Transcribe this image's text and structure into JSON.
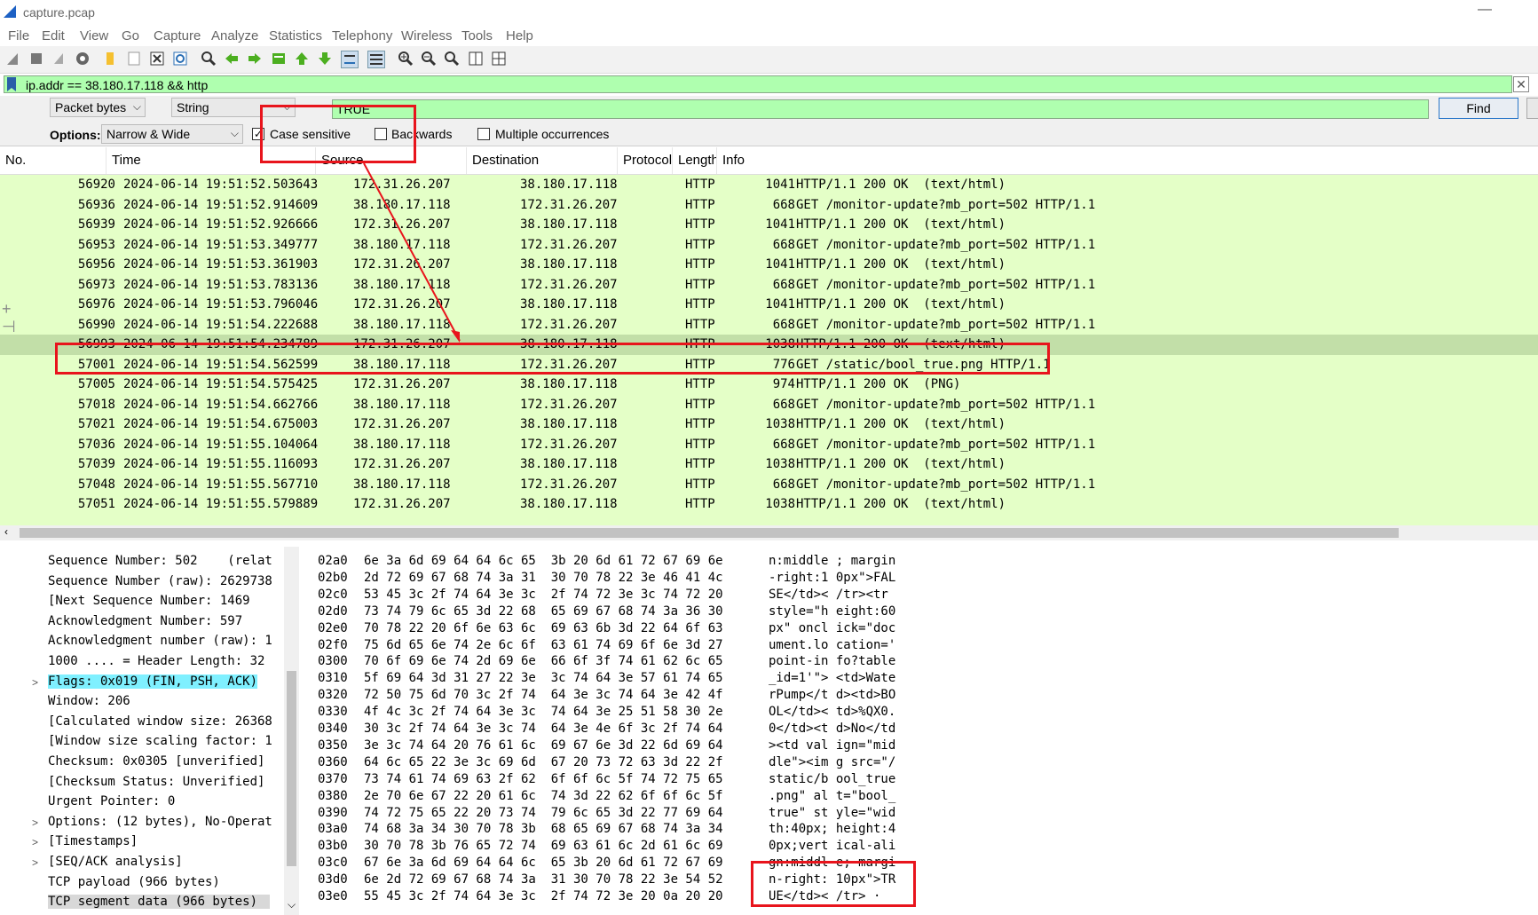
{
  "window": {
    "title": "capture.pcap"
  },
  "menu": [
    "File",
    "Edit",
    "View",
    "Go",
    "Capture",
    "Analyze",
    "Statistics",
    "Telephony",
    "Wireless",
    "Tools",
    "Help"
  ],
  "toolbar": {
    "icons": [
      "shark-fin-start-icon",
      "stop-icon",
      "restart-icon",
      "capture-options-icon",
      "open-file-icon",
      "file-icon",
      "close-file-icon",
      "reload-icon",
      "find-icon",
      "back-arrow-icon",
      "forward-arrow-icon",
      "go-to-packet-icon",
      "first-packet-icon",
      "last-packet-icon",
      "autoscroll-icon",
      "colorize-icon",
      "zoom-in-icon",
      "zoom-out-icon",
      "normal-size-icon",
      "resize-columns-icon",
      "layout-icon"
    ]
  },
  "filter": {
    "value": "ip.addr == 38.180.17.118 && http"
  },
  "find": {
    "search_in": "Packet bytes",
    "type": "String",
    "type_extra": "",
    "value": "TRUE",
    "button": "Find",
    "options_label": "Options:",
    "charset": "Narrow & Wide",
    "case_sensitive": "Case sensitive",
    "case_checked": "✓",
    "backwards": "Backwards",
    "multiple": "Multiple occurrences"
  },
  "packet_list": {
    "columns": [
      "No.",
      "Time",
      "Source",
      "Destination",
      "Protocol",
      "Length",
      "Info"
    ],
    "rows": [
      {
        "no": "56920",
        "time": "2024-06-14 19:51:52.503643",
        "src": "172.31.26.207",
        "dst": "38.180.17.118",
        "proto": "HTTP",
        "len": "1041",
        "info": "HTTP/1.1 200 OK  (text/html)"
      },
      {
        "no": "56936",
        "time": "2024-06-14 19:51:52.914609",
        "src": "38.180.17.118",
        "dst": "172.31.26.207",
        "proto": "HTTP",
        "len": "668",
        "info": "GET /monitor-update?mb_port=502 HTTP/1.1"
      },
      {
        "no": "56939",
        "time": "2024-06-14 19:51:52.926666",
        "src": "172.31.26.207",
        "dst": "38.180.17.118",
        "proto": "HTTP",
        "len": "1041",
        "info": "HTTP/1.1 200 OK  (text/html)"
      },
      {
        "no": "56953",
        "time": "2024-06-14 19:51:53.349777",
        "src": "38.180.17.118",
        "dst": "172.31.26.207",
        "proto": "HTTP",
        "len": "668",
        "info": "GET /monitor-update?mb_port=502 HTTP/1.1"
      },
      {
        "no": "56956",
        "time": "2024-06-14 19:51:53.361903",
        "src": "172.31.26.207",
        "dst": "38.180.17.118",
        "proto": "HTTP",
        "len": "1041",
        "info": "HTTP/1.1 200 OK  (text/html)"
      },
      {
        "no": "56973",
        "time": "2024-06-14 19:51:53.783136",
        "src": "38.180.17.118",
        "dst": "172.31.26.207",
        "proto": "HTTP",
        "len": "668",
        "info": "GET /monitor-update?mb_port=502 HTTP/1.1"
      },
      {
        "no": "56976",
        "time": "2024-06-14 19:51:53.796046",
        "src": "172.31.26.207",
        "dst": "38.180.17.118",
        "proto": "HTTP",
        "len": "1041",
        "info": "HTTP/1.1 200 OK  (text/html)"
      },
      {
        "no": "56990",
        "time": "2024-06-14 19:51:54.222688",
        "src": "38.180.17.118",
        "dst": "172.31.26.207",
        "proto": "HTTP",
        "len": "668",
        "info": "GET /monitor-update?mb_port=502 HTTP/1.1"
      },
      {
        "no": "56993",
        "time": "2024-06-14 19:51:54.234789",
        "src": "172.31.26.207",
        "dst": "38.180.17.118",
        "proto": "HTTP",
        "len": "1038",
        "info": "HTTP/1.1 200 OK  (text/html)"
      },
      {
        "no": "57001",
        "time": "2024-06-14 19:51:54.562599",
        "src": "38.180.17.118",
        "dst": "172.31.26.207",
        "proto": "HTTP",
        "len": "776",
        "info": "GET /static/bool_true.png HTTP/1.1"
      },
      {
        "no": "57005",
        "time": "2024-06-14 19:51:54.575425",
        "src": "172.31.26.207",
        "dst": "38.180.17.118",
        "proto": "HTTP",
        "len": "974",
        "info": "HTTP/1.1 200 OK  (PNG)"
      },
      {
        "no": "57018",
        "time": "2024-06-14 19:51:54.662766",
        "src": "38.180.17.118",
        "dst": "172.31.26.207",
        "proto": "HTTP",
        "len": "668",
        "info": "GET /monitor-update?mb_port=502 HTTP/1.1"
      },
      {
        "no": "57021",
        "time": "2024-06-14 19:51:54.675003",
        "src": "172.31.26.207",
        "dst": "38.180.17.118",
        "proto": "HTTP",
        "len": "1038",
        "info": "HTTP/1.1 200 OK  (text/html)"
      },
      {
        "no": "57036",
        "time": "2024-06-14 19:51:55.104064",
        "src": "38.180.17.118",
        "dst": "172.31.26.207",
        "proto": "HTTP",
        "len": "668",
        "info": "GET /monitor-update?mb_port=502 HTTP/1.1"
      },
      {
        "no": "57039",
        "time": "2024-06-14 19:51:55.116093",
        "src": "172.31.26.207",
        "dst": "38.180.17.118",
        "proto": "HTTP",
        "len": "1038",
        "info": "HTTP/1.1 200 OK  (text/html)"
      },
      {
        "no": "57048",
        "time": "2024-06-14 19:51:55.567710",
        "src": "38.180.17.118",
        "dst": "172.31.26.207",
        "proto": "HTTP",
        "len": "668",
        "info": "GET /monitor-update?mb_port=502 HTTP/1.1"
      },
      {
        "no": "57051",
        "time": "2024-06-14 19:51:55.579889",
        "src": "172.31.26.207",
        "dst": "38.180.17.118",
        "proto": "HTTP",
        "len": "1038",
        "info": "HTTP/1.1 200 OK  (text/html)"
      }
    ],
    "selected_no": "56993"
  },
  "details": [
    {
      "text": "Sequence Number: 502    (relat",
      "exp": ""
    },
    {
      "text": "Sequence Number (raw): 2629738",
      "exp": ""
    },
    {
      "text": "[Next Sequence Number: 1469",
      "exp": ""
    },
    {
      "text": "Acknowledgment Number: 597",
      "exp": ""
    },
    {
      "text": "Acknowledgment number (raw): 1",
      "exp": ""
    },
    {
      "text": "1000 .... = Header Length: 32",
      "exp": ""
    },
    {
      "text": "Flags: 0x019 (FIN, PSH, ACK)",
      "exp": ">",
      "highlight": true
    },
    {
      "text": "Window: 206",
      "exp": ""
    },
    {
      "text": "[Calculated window size: 26368",
      "exp": ""
    },
    {
      "text": "[Window size scaling factor: 1",
      "exp": ""
    },
    {
      "text": "Checksum: 0x0305 [unverified]",
      "exp": ""
    },
    {
      "text": "[Checksum Status: Unverified]",
      "exp": ""
    },
    {
      "text": "Urgent Pointer: 0",
      "exp": ""
    },
    {
      "text": "Options: (12 bytes), No-Operat",
      "exp": ">"
    },
    {
      "text": "[Timestamps]",
      "exp": ">"
    },
    {
      "text": "[SEQ/ACK analysis]",
      "exp": ">"
    },
    {
      "text": "TCP payload (966 bytes)",
      "exp": ""
    },
    {
      "text": "TCP segment data (966 bytes)",
      "exp": "",
      "selected": true
    }
  ],
  "bytes": [
    {
      "off": "02a0",
      "hex": "6e 3a 6d 69 64 64 6c 65  3b 20 6d 61 72 67 69 6e",
      "asc": "n:middle ; margin"
    },
    {
      "off": "02b0",
      "hex": "2d 72 69 67 68 74 3a 31  30 70 78 22 3e 46 41 4c",
      "asc": "-right:1 0px\">FAL"
    },
    {
      "off": "02c0",
      "hex": "53 45 3c 2f 74 64 3e 3c  2f 74 72 3e 3c 74 72 20",
      "asc": "SE</td>< /tr><tr"
    },
    {
      "off": "02d0",
      "hex": "73 74 79 6c 65 3d 22 68  65 69 67 68 74 3a 36 30",
      "asc": "style=\"h eight:60"
    },
    {
      "off": "02e0",
      "hex": "70 78 22 20 6f 6e 63 6c  69 63 6b 3d 22 64 6f 63",
      "asc": "px\" oncl ick=\"doc"
    },
    {
      "off": "02f0",
      "hex": "75 6d 65 6e 74 2e 6c 6f  63 61 74 69 6f 6e 3d 27",
      "asc": "ument.lo cation='"
    },
    {
      "off": "0300",
      "hex": "70 6f 69 6e 74 2d 69 6e  66 6f 3f 74 61 62 6c 65",
      "asc": "point-in fo?table"
    },
    {
      "off": "0310",
      "hex": "5f 69 64 3d 31 27 22 3e  3c 74 64 3e 57 61 74 65",
      "asc": "_id=1'\"> <td>Wate"
    },
    {
      "off": "0320",
      "hex": "72 50 75 6d 70 3c 2f 74  64 3e 3c 74 64 3e 42 4f",
      "asc": "rPump</t d><td>BO"
    },
    {
      "off": "0330",
      "hex": "4f 4c 3c 2f 74 64 3e 3c  74 64 3e 25 51 58 30 2e",
      "asc": "OL</td>< td>%QX0."
    },
    {
      "off": "0340",
      "hex": "30 3c 2f 74 64 3e 3c 74  64 3e 4e 6f 3c 2f 74 64",
      "asc": "0</td><t d>No</td"
    },
    {
      "off": "0350",
      "hex": "3e 3c 74 64 20 76 61 6c  69 67 6e 3d 22 6d 69 64",
      "asc": "><td val ign=\"mid"
    },
    {
      "off": "0360",
      "hex": "64 6c 65 22 3e 3c 69 6d  67 20 73 72 63 3d 22 2f",
      "asc": "dle\"><im g src=\"/"
    },
    {
      "off": "0370",
      "hex": "73 74 61 74 69 63 2f 62  6f 6f 6c 5f 74 72 75 65",
      "asc": "static/b ool_true"
    },
    {
      "off": "0380",
      "hex": "2e 70 6e 67 22 20 61 6c  74 3d 22 62 6f 6f 6c 5f",
      "asc": ".png\" al t=\"bool_"
    },
    {
      "off": "0390",
      "hex": "74 72 75 65 22 20 73 74  79 6c 65 3d 22 77 69 64",
      "asc": "true\" st yle=\"wid"
    },
    {
      "off": "03a0",
      "hex": "74 68 3a 34 30 70 78 3b  68 65 69 67 68 74 3a 34",
      "asc": "th:40px; height:4"
    },
    {
      "off": "03b0",
      "hex": "30 70 78 3b 76 65 72 74  69 63 61 6c 2d 61 6c 69",
      "asc": "0px;vert ical-ali"
    },
    {
      "off": "03c0",
      "hex": "67 6e 3a 6d 69 64 64 6c  65 3b 20 6d 61 72 67 69",
      "asc": "gn:middl e; margi"
    },
    {
      "off": "03d0",
      "hex": "6e 2d 72 69 67 68 74 3a  31 30 70 78 22 3e 54 52",
      "asc": "n-right: 10px\">TR"
    },
    {
      "off": "03e0",
      "hex": "55 45 3c 2f 74 64 3e 3c  2f 74 72 3e 20 0a 20 20",
      "asc": "UE</td>< /tr> ·"
    }
  ],
  "colors": {
    "filter_bg": "#afffaf",
    "row_bg": "#e4ffc7",
    "selected_row": "#c2dfa8",
    "annotation": "#e8141c",
    "flags_highlight": "#7ff0ff"
  }
}
